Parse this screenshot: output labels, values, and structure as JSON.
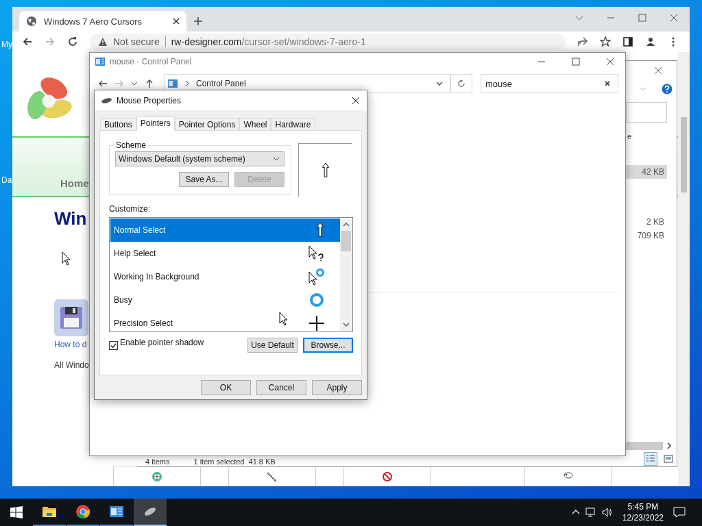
{
  "desktop": {
    "icon_labels": [
      {
        "text": "My"
      },
      {
        "text": "Da"
      }
    ]
  },
  "browser": {
    "tab_title": "Windows 7 Aero Cursors",
    "security": "Not secure",
    "url_host": "rw-designer.com",
    "url_path": "/cursor-set/windows-7-aero-1",
    "page": {
      "nav": "Home",
      "heading": "Win",
      "link": "How to d",
      "text": "All Windo"
    }
  },
  "explorer": {
    "fragment": "e",
    "files": [
      {
        "size": "42 KB",
        "selected": true
      },
      {
        "size": "2 KB",
        "selected": false
      },
      {
        "size": "709 KB",
        "selected": false
      }
    ],
    "status": [
      "4 items",
      "1 item selected  41.8 KB"
    ]
  },
  "control_panel": {
    "title": "mouse - Control Panel",
    "breadcrumb": "Control Panel",
    "search": "mouse"
  },
  "dialog": {
    "title": "Mouse Properties",
    "tabs": [
      {
        "label": "Buttons",
        "selected": false
      },
      {
        "label": "Pointers",
        "selected": true
      },
      {
        "label": "Pointer Options",
        "selected": false
      },
      {
        "label": "Wheel",
        "selected": false
      },
      {
        "label": "Hardware",
        "selected": false
      }
    ],
    "scheme_label": "Scheme",
    "scheme": "Windows Default (system scheme)",
    "scheme_buttons": [
      {
        "label": "Save As...",
        "disabled": false
      },
      {
        "label": "Delete",
        "disabled": true
      }
    ],
    "customize_label": "Customize:",
    "pointers": [
      {
        "name": "Normal Select",
        "kind": "normal",
        "selected": true
      },
      {
        "name": "Help Select",
        "kind": "help",
        "selected": false
      },
      {
        "name": "Working In Background",
        "kind": "working",
        "selected": false
      },
      {
        "name": "Busy",
        "kind": "busy",
        "selected": false
      },
      {
        "name": "Precision Select",
        "kind": "precision",
        "selected": false
      }
    ],
    "shadow": {
      "label": "Enable pointer shadow",
      "checked": true
    },
    "list_buttons": [
      {
        "label": "Use Default",
        "focused": false
      },
      {
        "label": "Browse...",
        "focused": true
      }
    ],
    "footer_buttons": [
      "OK",
      "Cancel",
      "Apply"
    ]
  },
  "taskbar": {
    "apps": [
      {
        "kind": "explorer",
        "selected": false
      },
      {
        "kind": "chrome",
        "selected": false
      },
      {
        "kind": "control-panel",
        "selected": false
      },
      {
        "kind": "mouse",
        "selected": true
      }
    ],
    "time": "5:45 PM",
    "date": "12/23/2022"
  }
}
